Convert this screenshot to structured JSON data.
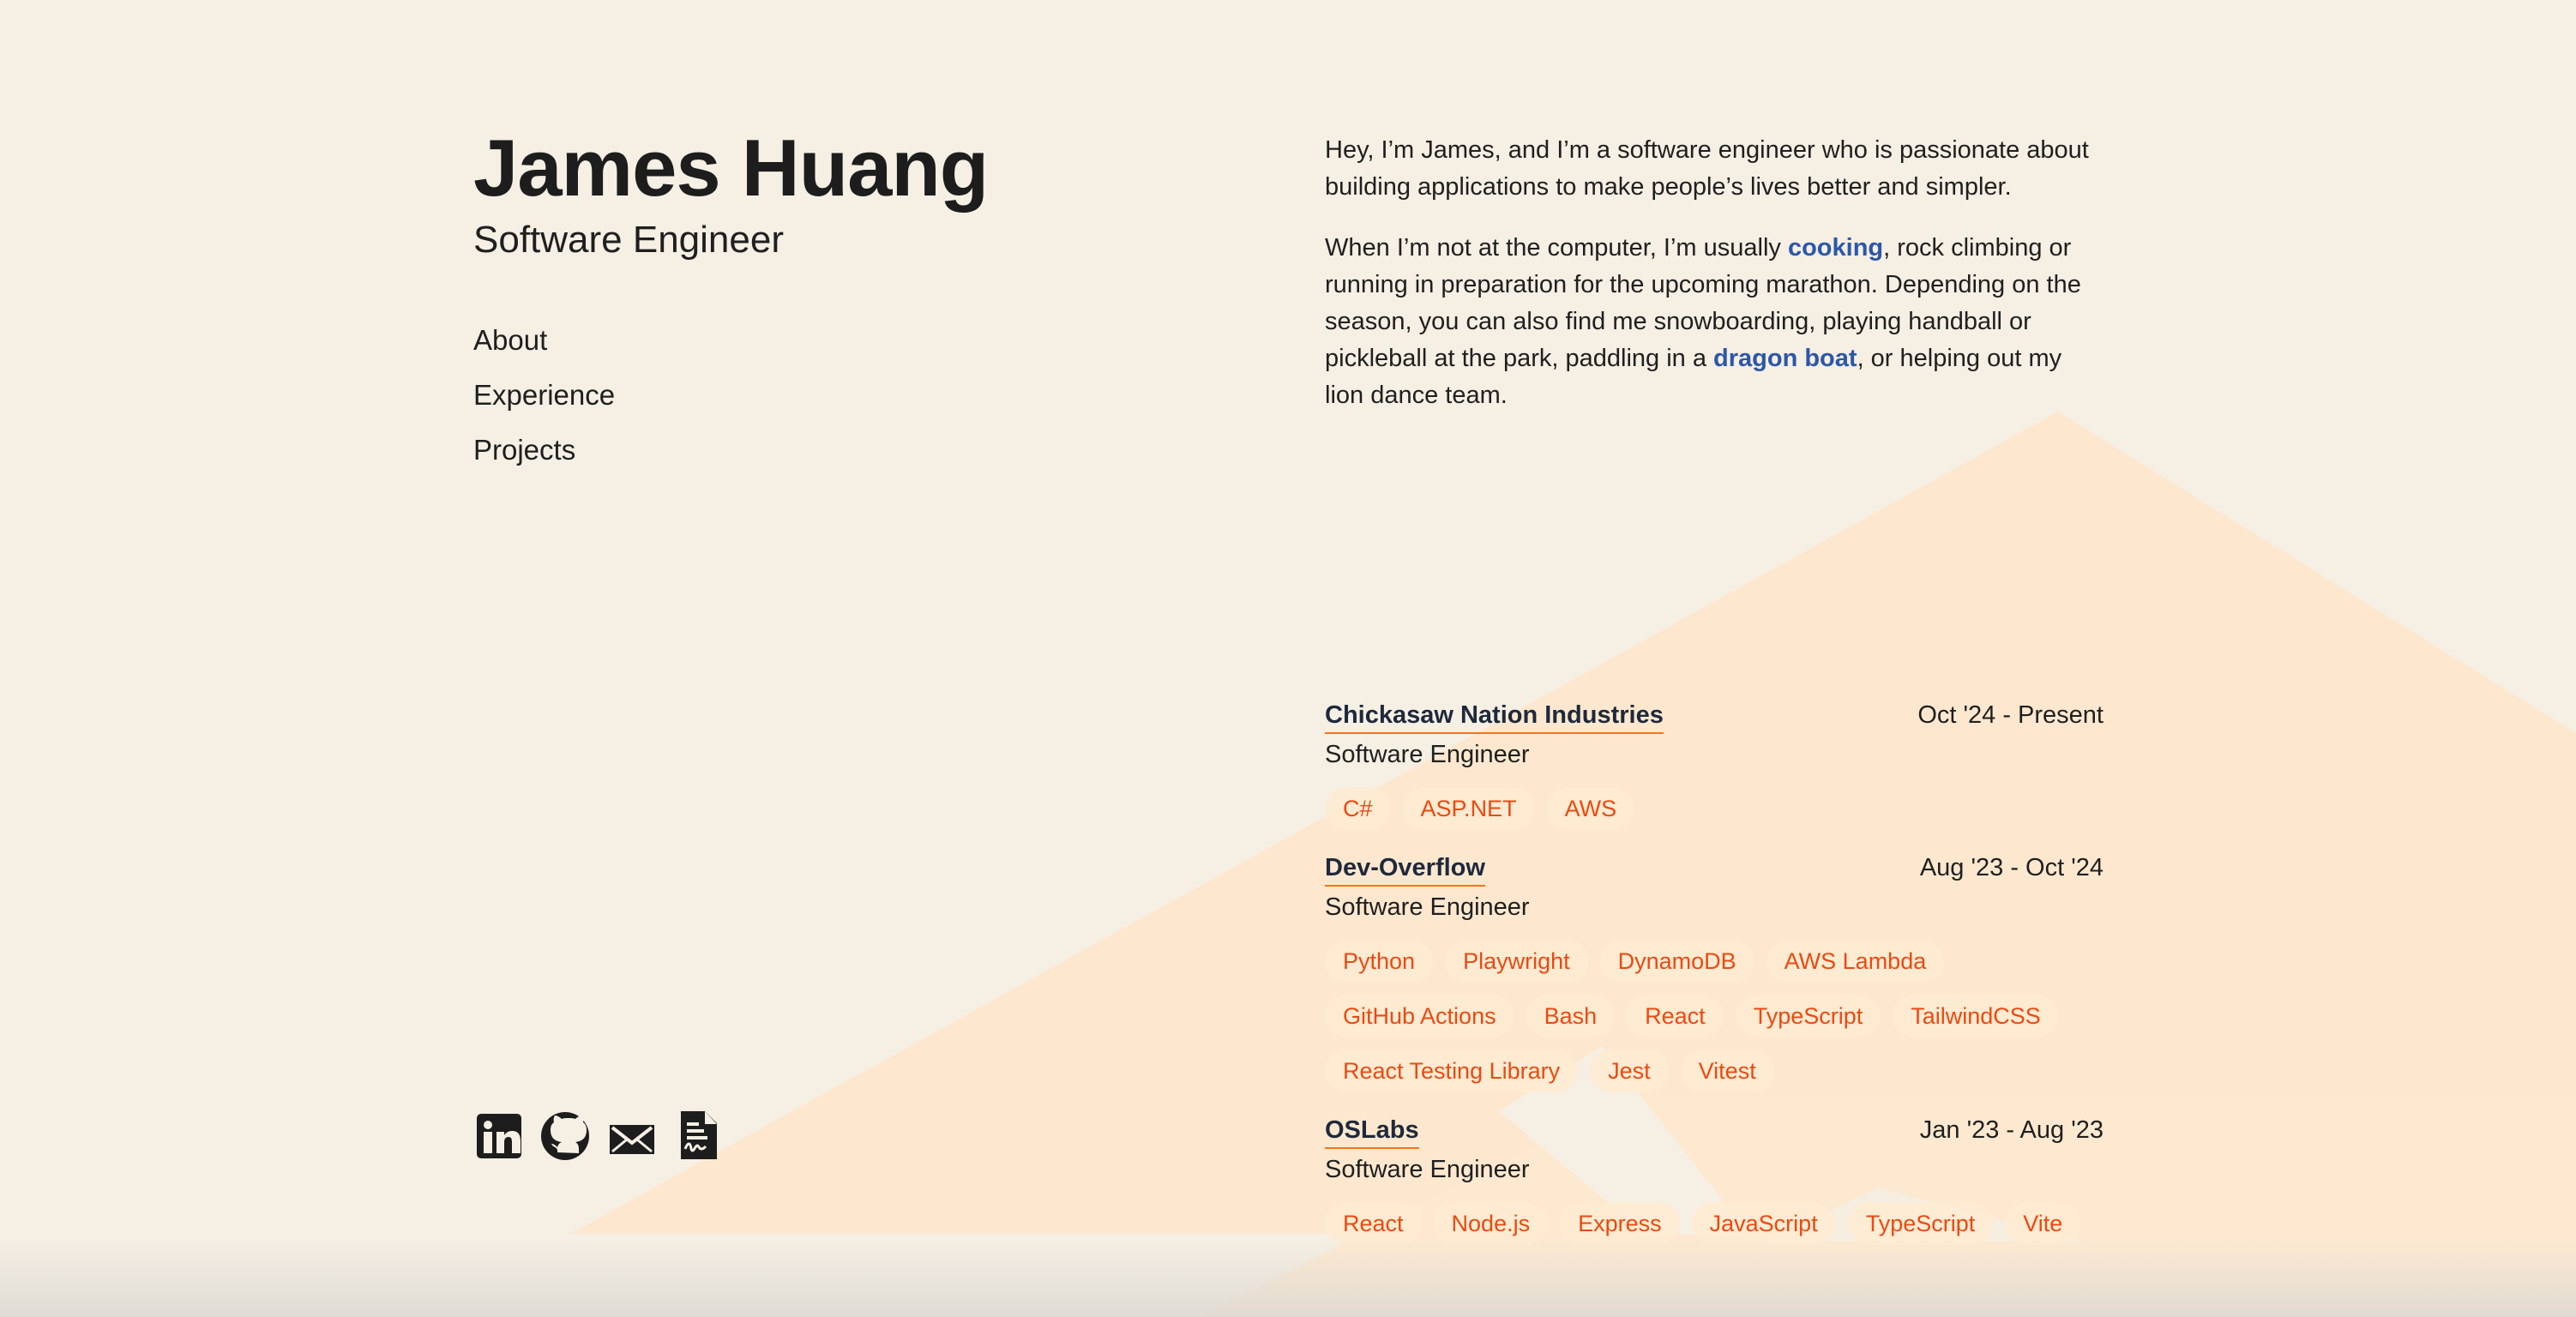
{
  "site": {
    "name": "James Huang",
    "role": "Software Engineer"
  },
  "nav": {
    "items": [
      {
        "label": "About"
      },
      {
        "label": "Experience"
      },
      {
        "label": "Projects"
      }
    ]
  },
  "about": {
    "paragraph_1": "Hey, I’m James, and I’m a software engineer who is passionate about building applications to make people’s lives better and simpler.",
    "paragraph_2_part_1": "When I’m not at the computer, I’m usually ",
    "paragraph_2_link_1": "cooking",
    "paragraph_2_part_2": ", rock climbing or running in preparation for the upcoming marathon. Depending on the season, you can also find me snowboarding, playing handball or pickleball at the park, paddling in a ",
    "paragraph_2_link_2": "dragon boat",
    "paragraph_2_part_3": ", or helping out my lion dance team."
  },
  "experience": {
    "jobs": [
      {
        "company": "Chickasaw Nation Industries",
        "dates": "Oct '24 - Present",
        "title": "Software Engineer",
        "tags": [
          "C#",
          "ASP.NET",
          "AWS"
        ]
      },
      {
        "company": "Dev-Overflow",
        "dates": "Aug '23 - Oct '24",
        "title": "Software Engineer",
        "tags": [
          "Python",
          "Playwright",
          "DynamoDB",
          "AWS Lambda",
          "GitHub Actions",
          "Bash",
          "React",
          "TypeScript",
          "TailwindCSS",
          "React Testing Library",
          "Jest",
          "Vitest"
        ]
      },
      {
        "company": "OSLabs",
        "dates": "Jan '23 - Aug '23",
        "title": "Software Engineer",
        "tags": [
          "React",
          "Node.js",
          "Express",
          "JavaScript",
          "TypeScript",
          "Vite"
        ]
      }
    ]
  },
  "socials": {
    "items": [
      {
        "icon": "linkedin-icon"
      },
      {
        "icon": "github-icon"
      },
      {
        "icon": "mail-icon"
      },
      {
        "icon": "resume-file-icon"
      }
    ]
  },
  "colors": {
    "background": "#f5efe4",
    "shape": "#fde8cf",
    "link": "#2c57a8",
    "tag_text": "#ea4a12",
    "underline": "#f97316"
  }
}
